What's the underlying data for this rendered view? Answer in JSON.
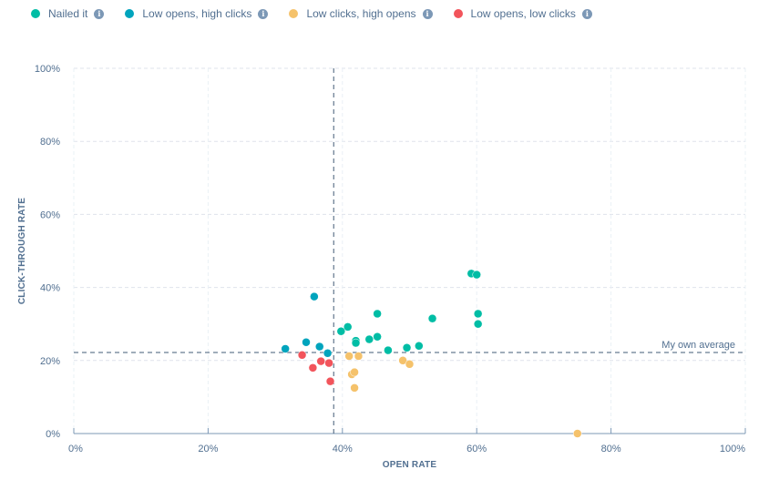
{
  "legend": [
    {
      "label": "Nailed it",
      "color": "#00bda5",
      "info_icon": "info-circle-icon"
    },
    {
      "label": "Low opens, high clicks",
      "color": "#00a4bd",
      "info_icon": "info-circle-icon"
    },
    {
      "label": "Low clicks, high opens",
      "color": "#f5c26b",
      "info_icon": "info-circle-icon"
    },
    {
      "label": "Low opens, low clicks",
      "color": "#f2545b",
      "info_icon": "info-circle-icon"
    }
  ],
  "chart_data": {
    "type": "scatter",
    "title": "",
    "xlabel": "OPEN RATE",
    "ylabel": "CLICK-THROUGH RATE",
    "xlim": [
      0,
      100
    ],
    "ylim": [
      0,
      100
    ],
    "x_ticks": [
      "0%",
      "20%",
      "40%",
      "60%",
      "80%",
      "100%"
    ],
    "y_ticks": [
      "0%",
      "20%",
      "40%",
      "60%",
      "80%",
      "100%"
    ],
    "grid": true,
    "legend_position": "top-left",
    "reference_lines": {
      "open_rate_average": 38.7,
      "ctr_average": 22.2,
      "ctr_average_label": "My own average"
    },
    "series": [
      {
        "name": "Nailed it",
        "color": "#00bda5",
        "points": [
          [
            39.8,
            28.0
          ],
          [
            40.8,
            29.2
          ],
          [
            42.0,
            25.4
          ],
          [
            42.0,
            24.8
          ],
          [
            44.0,
            25.8
          ],
          [
            45.2,
            26.5
          ],
          [
            45.2,
            32.8
          ],
          [
            46.8,
            22.8
          ],
          [
            49.6,
            23.5
          ],
          [
            51.4,
            24.0
          ],
          [
            53.4,
            31.5
          ],
          [
            59.2,
            43.8
          ],
          [
            60.0,
            43.5
          ],
          [
            60.2,
            32.8
          ],
          [
            60.2,
            30.0
          ]
        ]
      },
      {
        "name": "Low opens, high clicks",
        "color": "#00a4bd",
        "points": [
          [
            31.5,
            23.2
          ],
          [
            34.6,
            25.0
          ],
          [
            35.8,
            37.5
          ],
          [
            36.6,
            23.8
          ],
          [
            37.8,
            22.0
          ]
        ]
      },
      {
        "name": "Low clicks, high opens",
        "color": "#f5c26b",
        "points": [
          [
            41.0,
            21.2
          ],
          [
            42.4,
            21.2
          ],
          [
            41.4,
            16.2
          ],
          [
            41.8,
            16.8
          ],
          [
            41.8,
            12.5
          ],
          [
            49.0,
            20.0
          ],
          [
            50.0,
            19.0
          ],
          [
            75.0,
            0.0
          ]
        ]
      },
      {
        "name": "Low opens, low clicks",
        "color": "#f2545b",
        "points": [
          [
            34.0,
            21.5
          ],
          [
            35.6,
            18.0
          ],
          [
            36.8,
            19.8
          ],
          [
            38.0,
            19.3
          ],
          [
            38.2,
            14.3
          ]
        ]
      }
    ]
  }
}
